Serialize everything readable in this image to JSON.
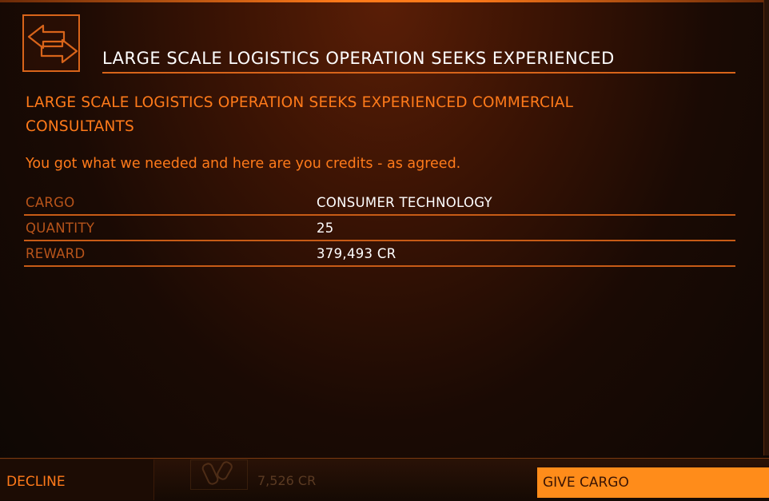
{
  "mission": {
    "title": "LARGE SCALE LOGISTICS OPERATION SEEKS EXPERIENCED",
    "subtitle": "LARGE SCALE LOGISTICS OPERATION SEEKS EXPERIENCED COMMERCIAL CONSULTANTS",
    "message": "You got what we needed and here are you credits - as agreed.",
    "icon": "transaction-arrows-icon"
  },
  "details": [
    {
      "label": "CARGO",
      "value": "CONSUMER TECHNOLOGY"
    },
    {
      "label": "QUANTITY",
      "value": "25"
    },
    {
      "label": "REWARD",
      "value": "379,493 CR"
    }
  ],
  "actions": {
    "decline_label": "DECLINE",
    "give_cargo_label": "GIVE CARGO"
  },
  "background_info": {
    "credits": "7,526 CR"
  },
  "colors": {
    "accent": "#ff7a1a",
    "button_primary": "#ff8c1a",
    "text_white": "#ffffff"
  }
}
